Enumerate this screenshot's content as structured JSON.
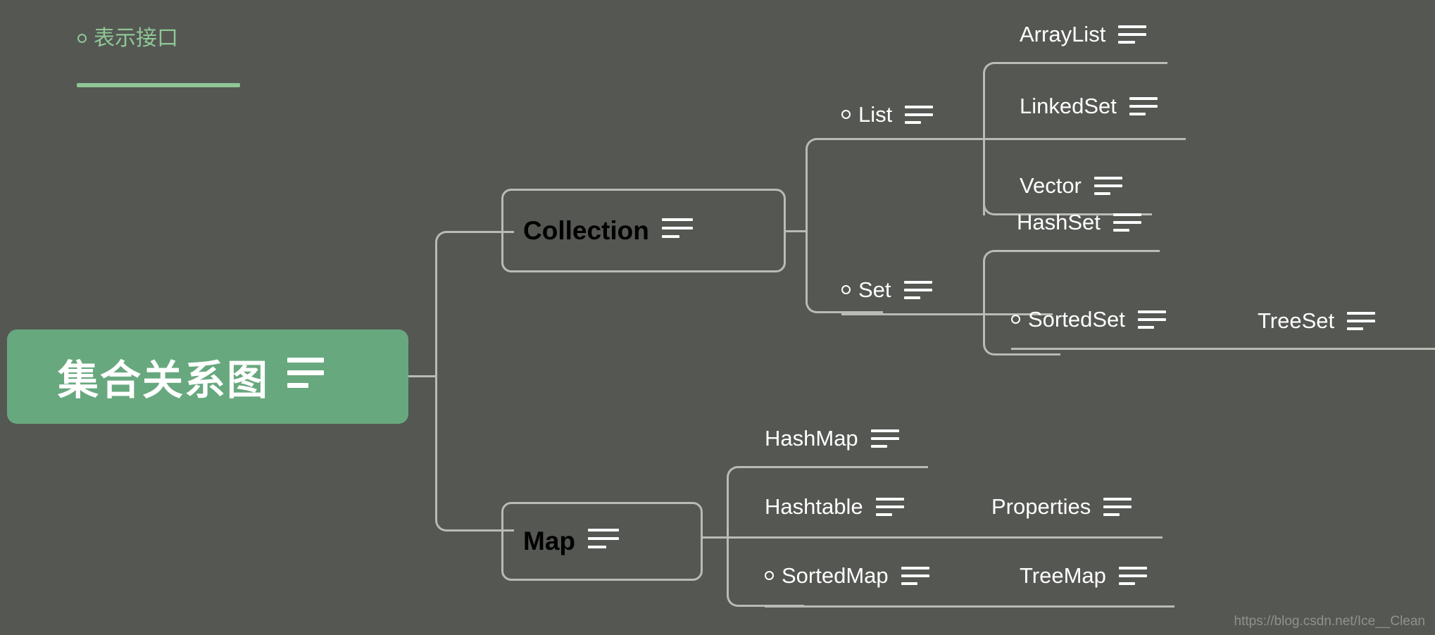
{
  "diagram": {
    "title": "集合关系图",
    "background_color": "#555753",
    "accent_color": "#68a87e",
    "line_color": "#b7bcb4",
    "text_color": "#ffffff",
    "legend_color": "#8fc795"
  },
  "legend": {
    "marker": "○",
    "text": "表示接口",
    "meaning": "circle marker indicates an interface"
  },
  "root": {
    "label": "集合关系图",
    "is_interface": false,
    "icon": "note-lines-icon"
  },
  "branches": [
    {
      "label": "Collection",
      "is_interface": true,
      "icon": "note-lines-icon",
      "children": [
        {
          "label": "List",
          "is_interface": true,
          "icon": "note-lines-icon",
          "children": [
            {
              "label": "ArrayList",
              "is_interface": false,
              "icon": "note-lines-icon",
              "children": []
            },
            {
              "label": "LinkedSet",
              "is_interface": false,
              "icon": "note-lines-icon",
              "children": []
            },
            {
              "label": "Vector",
              "is_interface": false,
              "icon": "note-lines-icon",
              "children": []
            }
          ]
        },
        {
          "label": "Set",
          "is_interface": true,
          "icon": "note-lines-icon",
          "children": [
            {
              "label": "HashSet",
              "is_interface": false,
              "icon": "note-lines-icon",
              "children": []
            },
            {
              "label": "SortedSet",
              "is_interface": true,
              "icon": "note-lines-icon",
              "children": [
                {
                  "label": "TreeSet",
                  "is_interface": false,
                  "icon": "note-lines-icon",
                  "children": []
                }
              ]
            }
          ]
        }
      ]
    },
    {
      "label": "Map",
      "is_interface": true,
      "icon": "note-lines-icon",
      "children": [
        {
          "label": "HashMap",
          "is_interface": false,
          "icon": "note-lines-icon",
          "children": []
        },
        {
          "label": "Hashtable",
          "is_interface": false,
          "icon": "note-lines-icon",
          "children": [
            {
              "label": "Properties",
              "is_interface": false,
              "icon": "note-lines-icon",
              "children": []
            }
          ]
        },
        {
          "label": "SortedMap",
          "is_interface": true,
          "icon": "note-lines-icon",
          "children": [
            {
              "label": "TreeMap",
              "is_interface": false,
              "icon": "note-lines-icon",
              "children": []
            }
          ]
        }
      ]
    }
  ],
  "nodes": {
    "root": "集合关系图",
    "collection": "Collection",
    "list": "List",
    "arraylist": "ArrayList",
    "linkedset": "LinkedSet",
    "vector": "Vector",
    "set": "Set",
    "hashset": "HashSet",
    "sortedset": "SortedSet",
    "treeset": "TreeSet",
    "map": "Map",
    "hashmap": "HashMap",
    "hashtable": "Hashtable",
    "properties": "Properties",
    "sortedmap": "SortedMap",
    "treemap": "TreeMap"
  },
  "watermark": {
    "text": "https://blog.csdn.net/Ice__Clean"
  }
}
